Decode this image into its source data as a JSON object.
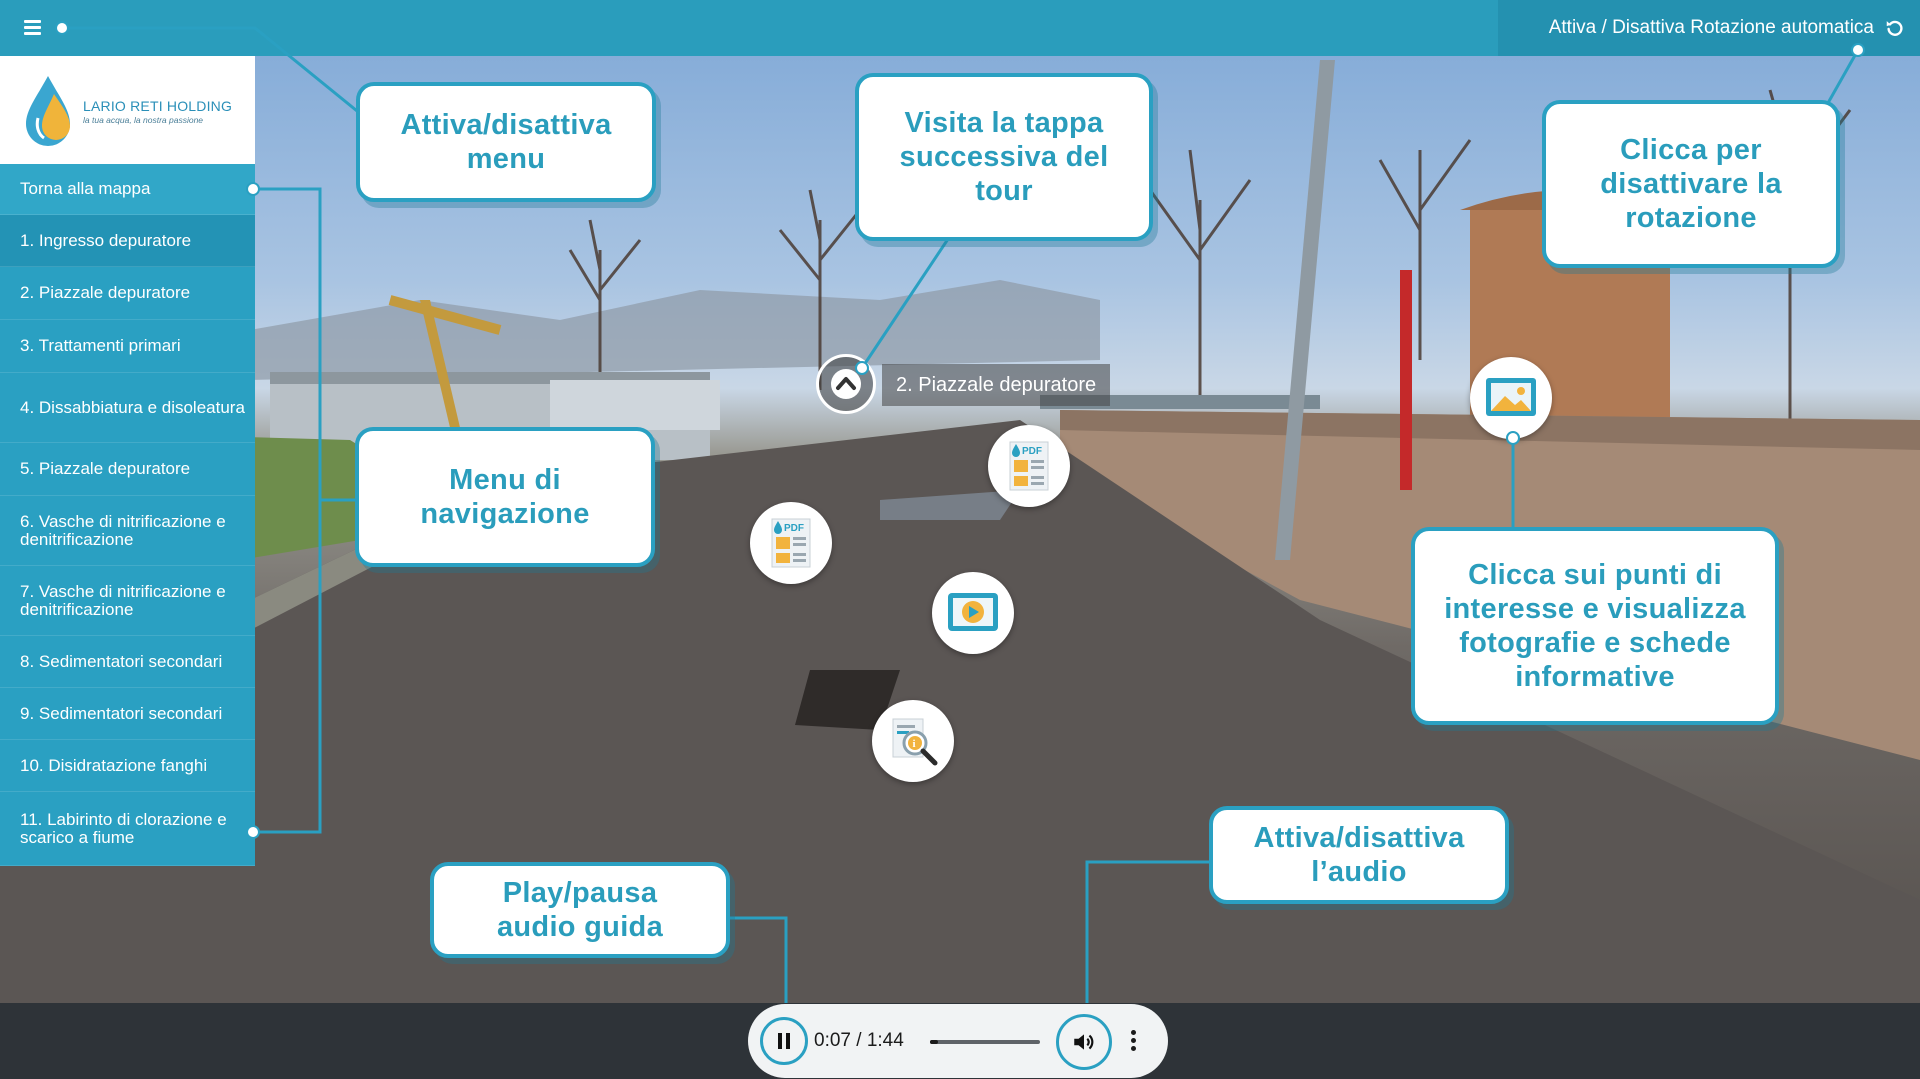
{
  "topbar": {
    "menu_icon": "hamburger-icon",
    "rotation_label": "Attiva / Disattiva Rotazione automatica",
    "rotation_icon": "rotate-icon"
  },
  "logo": {
    "name": "LARIO RETI HOLDING",
    "tagline": "la tua acqua, la nostra passione"
  },
  "sidebar": {
    "back_label": "Torna alla mappa",
    "items": [
      {
        "label": "1. Ingresso depuratore"
      },
      {
        "label": "2. Piazzale depuratore"
      },
      {
        "label": "3. Trattamenti primari"
      },
      {
        "label": "4. Dissabbiatura e disoleatura"
      },
      {
        "label": "5. Piazzale depuratore"
      },
      {
        "label": "6. Vasche di nitrificazione e denitrificazione"
      },
      {
        "label": "7. Vasche di nitrificazione e denitrificazione"
      },
      {
        "label": "8. Sedimentatori secondari"
      },
      {
        "label": "9. Sedimentatori secondari"
      },
      {
        "label": "10. Disidratazione fanghi"
      },
      {
        "label": "11. Labirinto di clorazione e scarico a fiume"
      }
    ]
  },
  "scene": {
    "next_stop_label": "2. Piazzale depuratore",
    "hotspots": [
      "pdf-icon",
      "pdf-icon",
      "video-play-icon",
      "info-search-icon",
      "image-icon"
    ]
  },
  "callouts": {
    "menu_toggle": "Attiva/disattiva menu",
    "next_stop": "Visita la tappa successiva del tour",
    "rotation": "Clicca per disattivare la rotazione",
    "navigation": "Menu di navigazione",
    "points_of_interest": "Clicca sui punti di interesse e visualizza fotografie e schede informative",
    "play_pause": "Play/pausa audio guida",
    "audio_toggle": "Attiva/disattiva l’audio"
  },
  "audio": {
    "time": "0:07 / 1:44",
    "progress": 0.07,
    "state": "playing"
  },
  "colors": {
    "accent": "#2aa0c2",
    "topbar": "#2a9dbc",
    "player_bg": "#f1f3f4",
    "bottom_bar": "#2e3338"
  }
}
